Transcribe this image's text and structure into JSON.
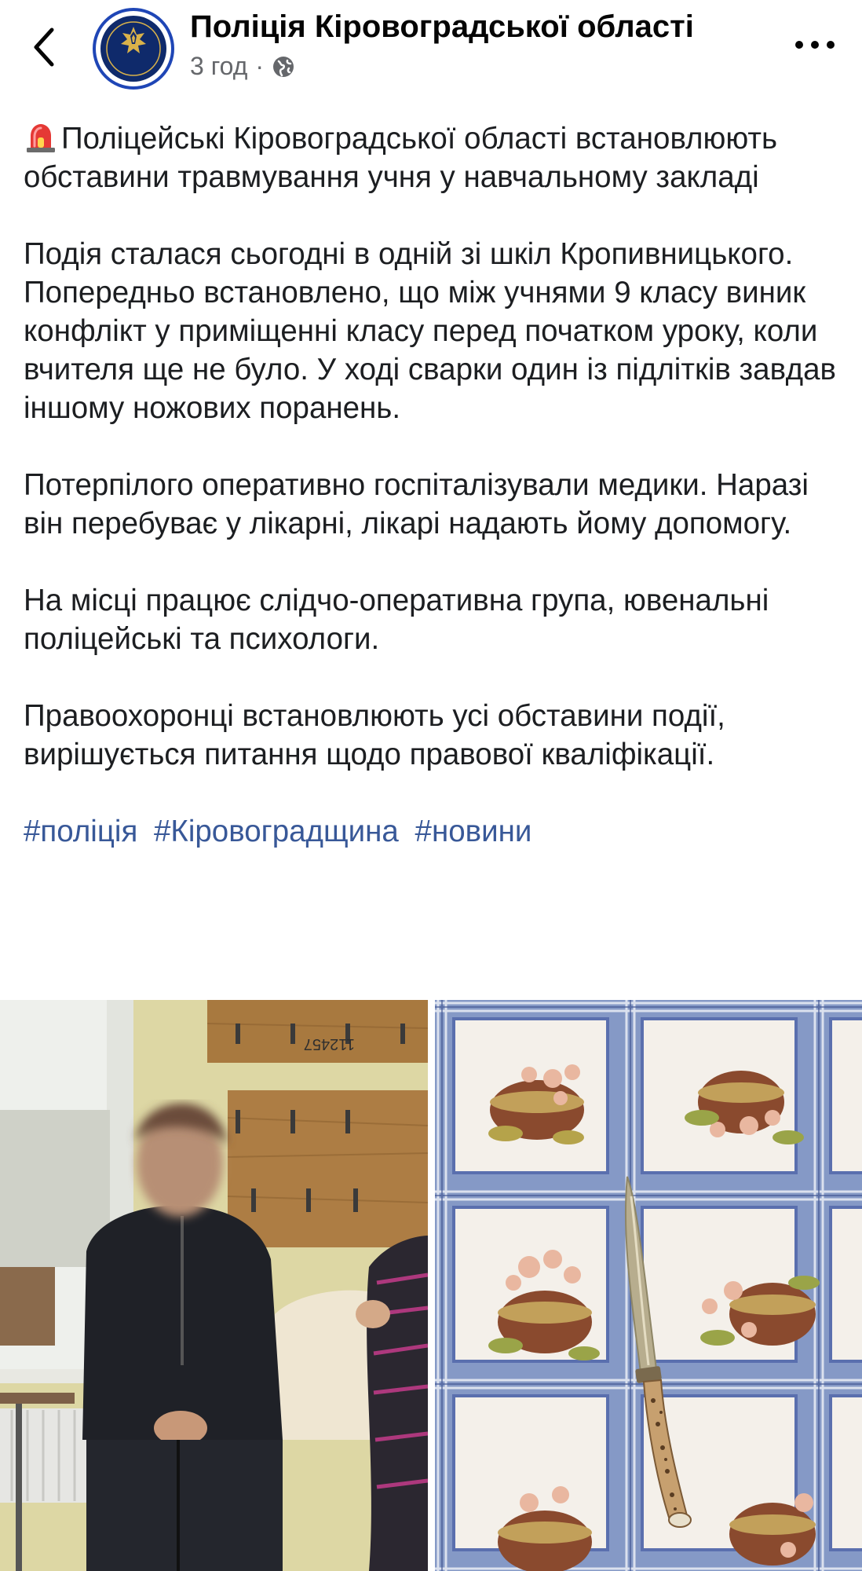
{
  "header": {
    "page_name": "Поліція Кіровоградської області",
    "time": "3 год",
    "separator": "·",
    "avatar_text": "ПОЛІЦІЯ КІРОВОГРАДСЬКОЇ ОБЛАСТІ"
  },
  "post": {
    "title": "Поліцейські Кіровоградської області встановлюють обставини травмування учня у навчальному закладі",
    "paragraphs": [
      "Подія сталася сьогодні в одній зі шкіл Кропивницького. Попередньо встановлено, що між учнями 9 класу виник конфлікт у приміщенні класу перед початком уроку, коли вчителя ще не було. У ході сварки один із підлітків завдав іншому ножових поранень.",
      "Потерпілого оперативно госпіталізували медики. Наразі він перебуває у лікарні, лікарі надають йому допомогу.",
      "На місці працює слідчо-оперативна група, ювенальні поліцейські та психологи.",
      "Правоохоронці встановлюють усі обставини події, вирішується питання щодо правової кваліфікації."
    ],
    "hashtags": [
      "#поліція",
      "#Кіровоградщина",
      "#новини"
    ]
  },
  "photos": {
    "left_handwriting": "112457",
    "count": 2
  },
  "colors": {
    "hashtag": "#385898",
    "avatar_ring": "#1f46b6",
    "text": "#1c1e21",
    "meta": "#65676b"
  },
  "icons": [
    "back-chevron-icon",
    "globe-icon",
    "more-dots-icon",
    "siren-icon"
  ]
}
